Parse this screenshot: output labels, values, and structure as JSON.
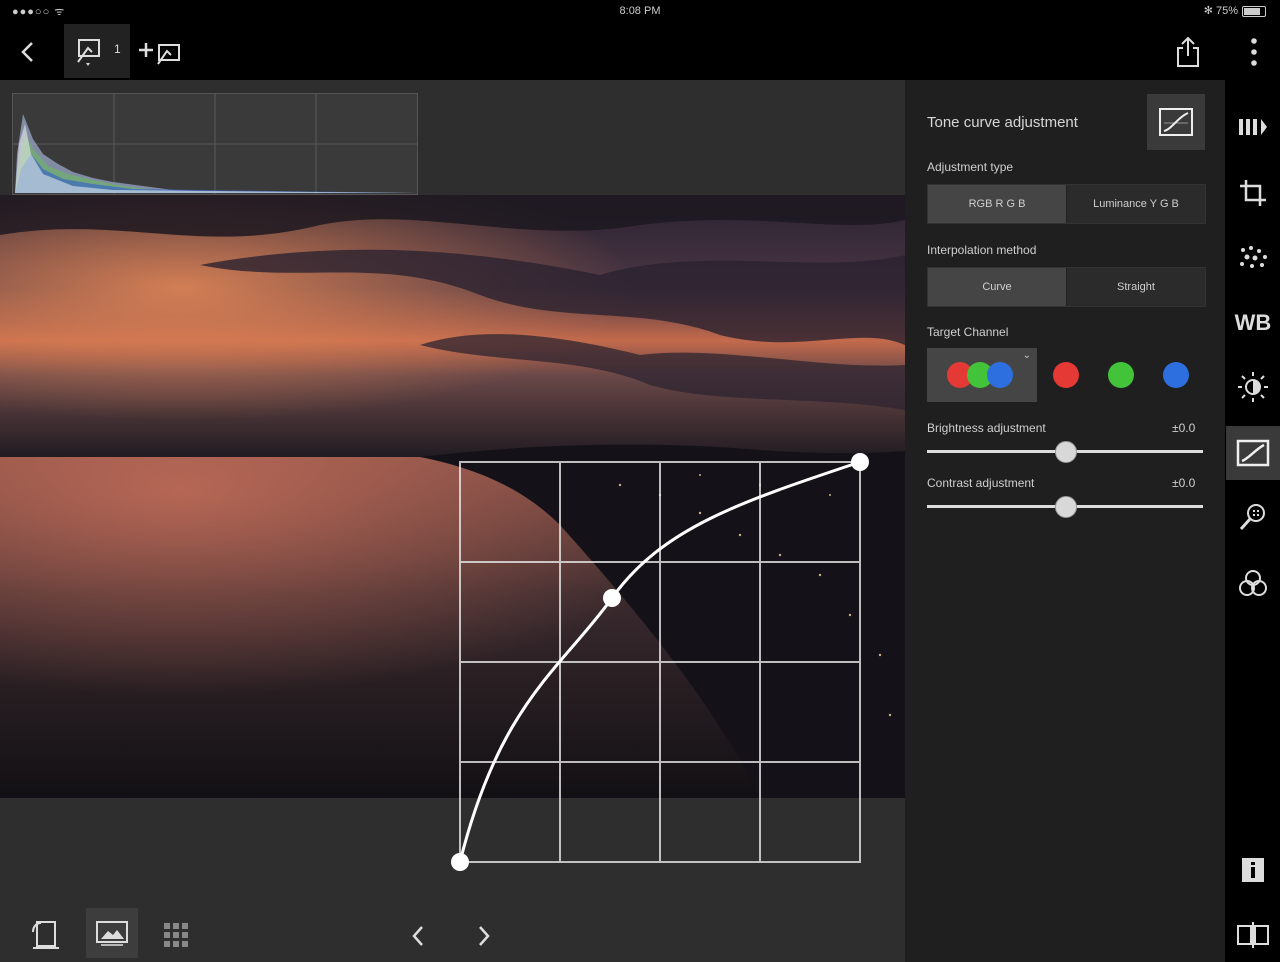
{
  "status_bar": {
    "carrier": "●●●○○ ᯤ",
    "time": "8:08 PM",
    "battery_text": "✻ 75%"
  },
  "toolbar": {
    "tab_count": "1",
    "icons": [
      "back-icon",
      "photo-edit-tab-icon",
      "add-photo-icon",
      "share-icon",
      "more-vert-icon"
    ]
  },
  "panel": {
    "title": "Tone curve adjustment",
    "adjustment_type_label": "Adjustment type",
    "adjustment_type_options": [
      "RGB R G B",
      "Luminance Y G B"
    ],
    "adjustment_type_selected": 0,
    "interpolation_label": "Interpolation method",
    "interpolation_options": [
      "Curve",
      "Straight"
    ],
    "interpolation_selected": 0,
    "target_channel_label": "Target Channel",
    "channels": [
      "rgb",
      "red",
      "green",
      "blue"
    ],
    "channel_colors": {
      "red": "#e53935",
      "green": "#43c33a",
      "blue": "#2e6fe0"
    },
    "brightness_label": "Brightness adjustment",
    "brightness_value": "±0.0",
    "brightness_level": 0.5,
    "contrast_label": "Contrast adjustment",
    "contrast_value": "±0.0",
    "contrast_level": 0.5
  },
  "rail_icons": [
    "compare-icon",
    "crop-icon",
    "noise-icon",
    "wb-icon",
    "brightness-icon",
    "tone-curve-icon",
    "detail-zoom-icon",
    "color-filter-icon",
    "info-icon",
    "compare-split-icon"
  ],
  "rail_wb_text": "WB",
  "rail_selected": "tone-curve-icon",
  "bottom_icons": [
    "rotate-icon",
    "single-view-icon",
    "grid-view-icon",
    "prev-icon",
    "next-icon"
  ],
  "tone_curve": {
    "points": [
      [
        0,
        0
      ],
      [
        0.38,
        0.66
      ],
      [
        1,
        1
      ]
    ]
  },
  "accent": "#454545"
}
